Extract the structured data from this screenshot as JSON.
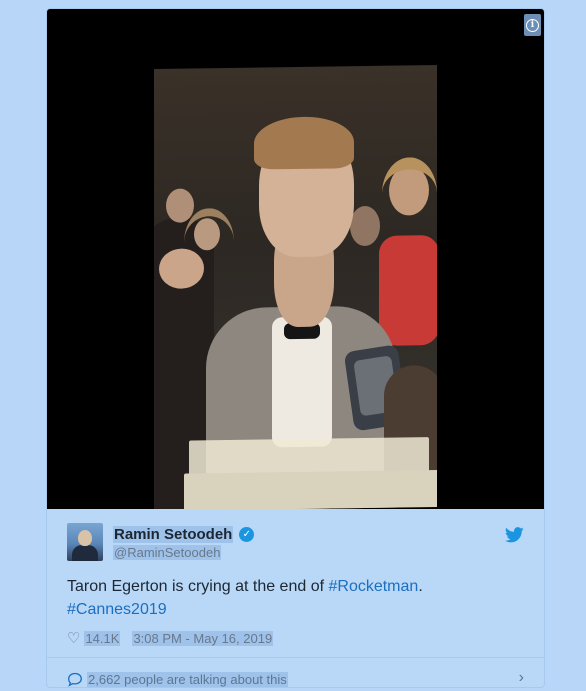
{
  "media": {
    "info_icon": "info-icon",
    "info_glyph": "i"
  },
  "tweet": {
    "author_name": "Ramin Setoodeh",
    "author_handle": "@RaminSetoodeh",
    "verified_glyph": "✓",
    "text_plain_1": "Taron Egerton is crying at the end of ",
    "hashtag_1": "#Rocketman",
    "text_plain_2": ".",
    "hashtag_2": "#Cannes2019",
    "like_glyph": "♡",
    "likes": "14.1K",
    "timestamp": "3:08 PM - May 16, 2019",
    "conversation": "2,662 people are talking about this",
    "chevron": "›"
  },
  "colors": {
    "link": "#1b6fbf",
    "twitter_blue": "#1b95e0",
    "card_bg": "#b9d8f8"
  }
}
